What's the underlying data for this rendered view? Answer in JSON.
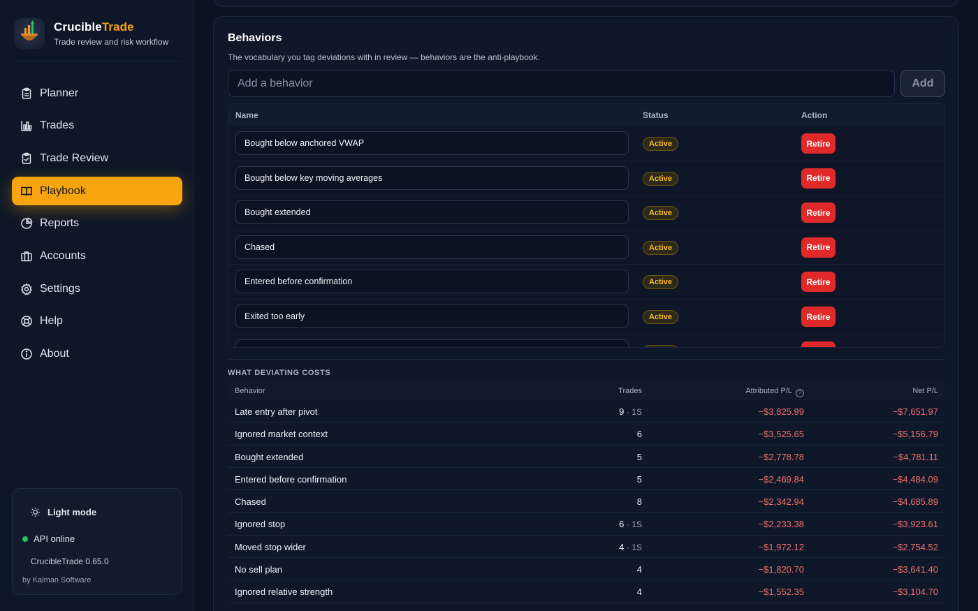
{
  "brand": {
    "name_part1": "Crucible",
    "name_part2": "Trade",
    "subtitle": "Trade review and risk workflow"
  },
  "nav": [
    {
      "label": "Planner",
      "icon": "clipboard-icon",
      "active": false
    },
    {
      "label": "Trades",
      "icon": "chart-bars-icon",
      "active": false
    },
    {
      "label": "Trade Review",
      "icon": "clipboard-check-icon",
      "active": false
    },
    {
      "label": "Playbook",
      "icon": "book-open-icon",
      "active": true
    },
    {
      "label": "Reports",
      "icon": "pie-chart-icon",
      "active": false
    },
    {
      "label": "Accounts",
      "icon": "briefcase-icon",
      "active": false
    },
    {
      "label": "Settings",
      "icon": "gear-icon",
      "active": false
    },
    {
      "label": "Help",
      "icon": "lifebuoy-icon",
      "active": false
    },
    {
      "label": "About",
      "icon": "info-icon",
      "active": false
    }
  ],
  "status_card": {
    "light_mode": "Light mode",
    "api_status": "API online",
    "version": "CrucibleTrade 0.65.0",
    "byline": "by Kalman Software"
  },
  "behaviors": {
    "title": "Behaviors",
    "description": "The vocabulary you tag deviations with in review — behaviors are the anti-playbook.",
    "add_placeholder": "Add a behavior",
    "add_label": "Add",
    "columns": {
      "name": "Name",
      "status": "Status",
      "action": "Action"
    },
    "rows": [
      {
        "name": "Bought below anchored VWAP",
        "status": "Active",
        "action": "Retire"
      },
      {
        "name": "Bought below key moving averages",
        "status": "Active",
        "action": "Retire"
      },
      {
        "name": "Bought extended",
        "status": "Active",
        "action": "Retire"
      },
      {
        "name": "Chased",
        "status": "Active",
        "action": "Retire"
      },
      {
        "name": "Entered before confirmation",
        "status": "Active",
        "action": "Retire"
      },
      {
        "name": "Exited too early",
        "status": "Active",
        "action": "Retire"
      },
      {
        "name": "",
        "status": "",
        "action": ""
      }
    ]
  },
  "costs": {
    "section_label": "WHAT DEVIATING COSTS",
    "columns": {
      "behavior": "Behavior",
      "trades": "Trades",
      "attributed": "Attributed P/L",
      "net": "Net P/L"
    },
    "rows": [
      {
        "behavior": "Late entry after pivot",
        "trades": "9",
        "extra": "· 1S",
        "attributed": "−$3,825.99",
        "net": "−$7,651.97"
      },
      {
        "behavior": "Ignored market context",
        "trades": "6",
        "extra": "",
        "attributed": "−$3,525.65",
        "net": "−$5,156.79"
      },
      {
        "behavior": "Bought extended",
        "trades": "5",
        "extra": "",
        "attributed": "−$2,778.78",
        "net": "−$4,781.11"
      },
      {
        "behavior": "Entered before confirmation",
        "trades": "5",
        "extra": "",
        "attributed": "−$2,469.84",
        "net": "−$4,484.09"
      },
      {
        "behavior": "Chased",
        "trades": "8",
        "extra": "",
        "attributed": "−$2,342.94",
        "net": "−$4,685.89"
      },
      {
        "behavior": "Ignored stop",
        "trades": "6",
        "extra": "· 1S",
        "attributed": "−$2,233.38",
        "net": "−$3,923.61"
      },
      {
        "behavior": "Moved stop wider",
        "trades": "4",
        "extra": "· 1S",
        "attributed": "−$1,972.12",
        "net": "−$2,754.52"
      },
      {
        "behavior": "No sell plan",
        "trades": "4",
        "extra": "",
        "attributed": "−$1,820.70",
        "net": "−$3,641.40"
      },
      {
        "behavior": "Ignored relative strength",
        "trades": "4",
        "extra": "",
        "attributed": "−$1,552.35",
        "net": "−$3,104.70"
      }
    ]
  },
  "colors": {
    "accent": "#f7a40f",
    "danger": "#e02a2a",
    "negative": "#f07070",
    "online": "#22c55e"
  }
}
